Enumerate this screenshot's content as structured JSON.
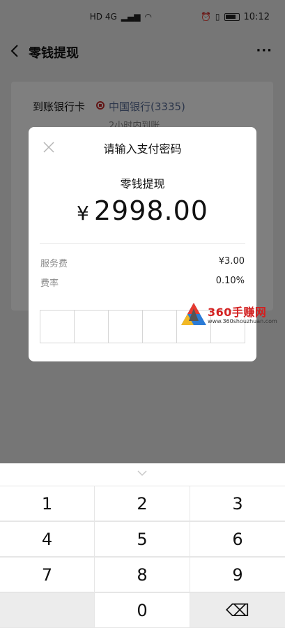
{
  "status_bar": {
    "network": "HD 4G",
    "time": "10:12"
  },
  "nav": {
    "title": "零钱提现"
  },
  "card": {
    "label": "到账银行卡",
    "bank": "中国银行(3335)",
    "arrival_note": "2小时内到账"
  },
  "dialog": {
    "title": "请输入支付密码",
    "subtitle": "零钱提现",
    "currency": "¥",
    "amount": "2998.00",
    "fee_label": "服务费",
    "fee_value": "¥3.00",
    "rate_label": "费率",
    "rate_value": "0.10%"
  },
  "watermark": {
    "brand": "360手赚网",
    "url": "www.360shouzhuan.com"
  },
  "keypad": {
    "keys": [
      "1",
      "2",
      "3",
      "4",
      "5",
      "6",
      "7",
      "8",
      "9",
      "",
      "0",
      "⌫"
    ]
  },
  "colors": {
    "overlay": "rgba(0,0,0,0.5)",
    "link": "#576b95",
    "bank_red": "#c52b2b"
  }
}
